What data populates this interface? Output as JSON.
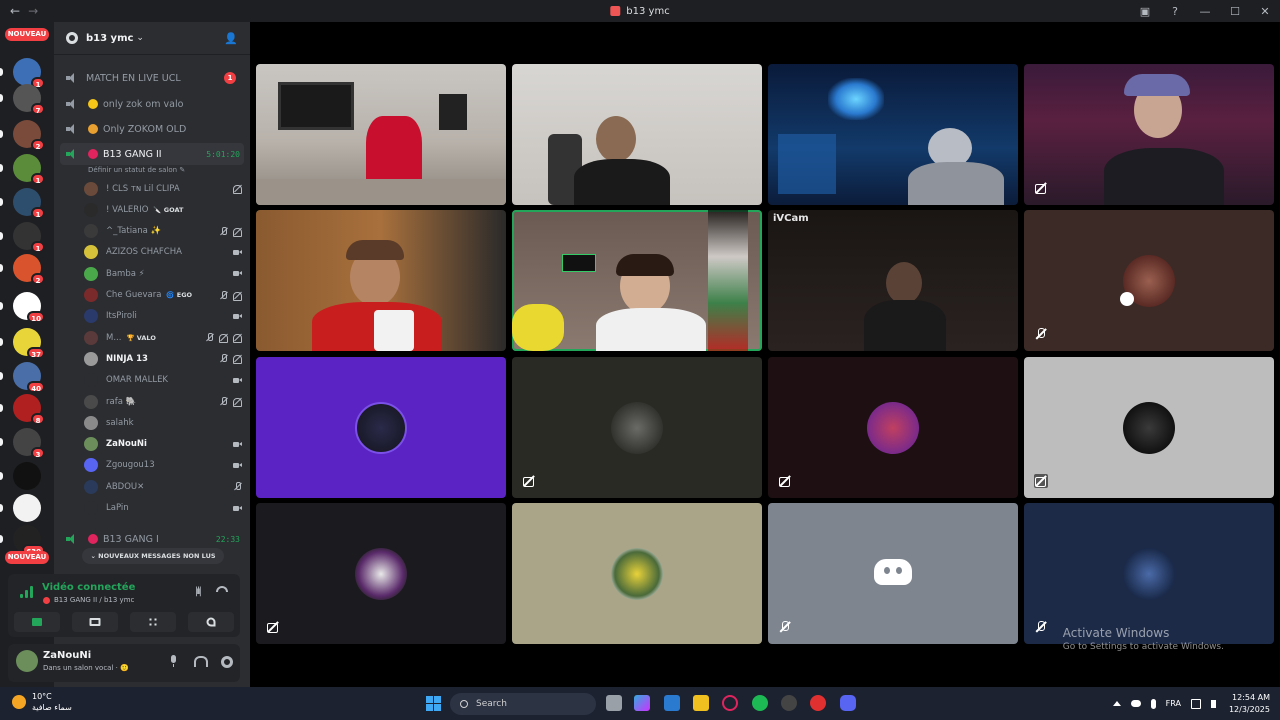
{
  "window": {
    "title": "b13 ymc",
    "back_glyph": "←",
    "forward_glyph": "→",
    "controls": [
      "▣",
      "?",
      "—",
      "☐",
      "✕"
    ]
  },
  "rail": {
    "new_label_top": "NOUVEAU",
    "new_label_bottom": "NOUVEAU",
    "servers": [
      {
        "badge": "1",
        "color": "#3d6fb6"
      },
      {
        "badge": "7",
        "color": "#555555"
      },
      {
        "badge": "2",
        "color": "#7a4a3a"
      },
      {
        "badge": "1",
        "color": "#5b8c3a"
      },
      {
        "badge": "1",
        "color": "#2e4e6e"
      },
      {
        "badge": "1",
        "color": "#333333"
      },
      {
        "badge": "2",
        "color": "#d9532c"
      },
      {
        "badge": "10",
        "color": "#ffffff"
      },
      {
        "badge": "37",
        "color": "#e8d53a"
      },
      {
        "badge": "40",
        "color": "#4a6ea8"
      },
      {
        "badge": "8",
        "color": "#b02020"
      },
      {
        "badge": "3",
        "color": "#444444"
      },
      {
        "badge": "",
        "color": "#111111"
      },
      {
        "badge": "",
        "color": "#f2f2f2"
      },
      {
        "badge": "630",
        "color": "#222222"
      }
    ]
  },
  "server": {
    "name": "b13 ymc",
    "chevron": "⌄",
    "invite_glyph": "👤"
  },
  "channels": [
    {
      "name": "MATCH EN LIVE UCL",
      "badge": "1",
      "emoji_color": ""
    },
    {
      "name": "only zok om valo",
      "badge": "",
      "emoji_color": "#f5c518"
    },
    {
      "name": "Only ZOKOM OLD",
      "badge": "",
      "emoji_color": "#e8a030"
    },
    {
      "name": "B13 GANG II",
      "badge": "",
      "emoji_color": "#e0245e",
      "timer": "5:01:20"
    }
  ],
  "status_line": "Définir un statut de salon ✎",
  "members": [
    {
      "name": "! CLS ᴛɴ Lil CLIPA",
      "tag": "",
      "bright": false,
      "color": "#6a4a3a",
      "icons": [
        "deaf"
      ]
    },
    {
      "name": "! VALERIO",
      "tag": "🔪 GOAT",
      "bright": false,
      "color": "#2a2a2a",
      "icons": []
    },
    {
      "name": "^_Tatiana ✨",
      "tag": "",
      "bright": false,
      "color": "#3a3a3a",
      "icons": [
        "mute",
        "deaf"
      ]
    },
    {
      "name": "AZIZOS CHAFCHA",
      "tag": "",
      "bright": false,
      "color": "#d6c23a",
      "icons": [
        "cam"
      ]
    },
    {
      "name": "Bamba ⚡",
      "tag": "",
      "bright": false,
      "color": "#4aa84a",
      "icons": [
        "cam"
      ]
    },
    {
      "name": "Che Guevara",
      "tag": "🌀 EGO",
      "bright": false,
      "color": "#7a2a2a",
      "icons": [
        "mute",
        "deaf"
      ]
    },
    {
      "name": "ItsPiroli",
      "tag": "",
      "bright": false,
      "color": "#2a3a6a",
      "icons": [
        "cam"
      ]
    },
    {
      "name": "M...",
      "tag": "🏆 VALO",
      "bright": false,
      "color": "#5a3a3a",
      "icons": [
        "mute",
        "deaf",
        "deaf"
      ]
    },
    {
      "name": "NINJA 13",
      "tag": "",
      "bright": true,
      "color": "#9a9a9a",
      "icons": [
        "mute",
        "deaf"
      ]
    },
    {
      "name": "OMAR MALLEK",
      "tag": "",
      "bright": false,
      "color": "#2b2d31",
      "icons": [
        "cam"
      ]
    },
    {
      "name": "rafa 🐘",
      "tag": "",
      "bright": false,
      "color": "#4a4a4a",
      "icons": [
        "mute",
        "deaf"
      ]
    },
    {
      "name": "salahk",
      "tag": "",
      "bright": false,
      "color": "#8a8a8a",
      "icons": []
    },
    {
      "name": "ZaNouNi",
      "tag": "",
      "bright": true,
      "color": "#6b8e5a",
      "icons": [
        "cam"
      ]
    },
    {
      "name": "Zgougou13",
      "tag": "",
      "bright": false,
      "color": "#5865f2",
      "icons": [
        "cam"
      ]
    },
    {
      "name": "ABDOU✕",
      "tag": "",
      "bright": false,
      "color": "#2a3a5a",
      "icons": [
        "mute"
      ]
    },
    {
      "name": "LaPin",
      "tag": "",
      "bright": false,
      "color": "#2b2d31",
      "icons": [
        "cam"
      ]
    }
  ],
  "channel_after": {
    "name": "B13 GANG I",
    "timer": "22:33",
    "emoji_color": "#e0245e"
  },
  "unread_bar": "⌄ NOUVEAUX MESSAGES NON LUS",
  "voice": {
    "title": "Vidéo connectée",
    "subtitle": "B13 GANG II / b13 ymc"
  },
  "user": {
    "name": "ZaNouNi",
    "status": "Dans un salon vocal · 🙂"
  },
  "stage": {
    "tile_label": "iVCam",
    "watermark_title": "Activate Windows",
    "watermark_sub": "Go to Settings to activate Windows."
  },
  "taskbar": {
    "temp": "10°C",
    "weather": "سماء صافية",
    "search": "Search",
    "lang": "FRA",
    "time": "12:54 AM",
    "date": "12/3/2025"
  }
}
